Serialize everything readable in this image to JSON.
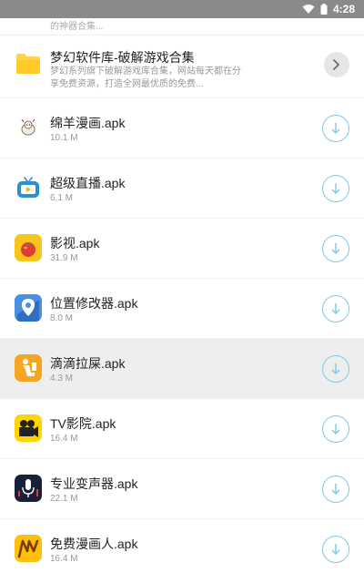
{
  "status_bar": {
    "time": "4:28"
  },
  "previous_item": {
    "desc_tail": "的神器合集..."
  },
  "folder": {
    "title": "梦幻软件库-破解游戏合集",
    "description": "梦幻系列旗下破解游戏库合集，网站每天都在分享免费资源，打造全网最优质的免费..."
  },
  "apps": [
    {
      "name": "绵羊漫画.apk",
      "size": "10.1 M",
      "icon": "sheep-comic-icon"
    },
    {
      "name": "超级直播.apk",
      "size": "6.1 M",
      "icon": "tv-live-icon"
    },
    {
      "name": "影视.apk",
      "size": "31.9 M",
      "icon": "tomato-video-icon"
    },
    {
      "name": "位置修改器.apk",
      "size": "8.0 M",
      "icon": "location-pin-icon"
    },
    {
      "name": "滴滴拉屎.apk",
      "size": "4.3 M",
      "icon": "toilet-figure-icon"
    },
    {
      "name": "TV影院.apk",
      "size": "16.4 M",
      "icon": "film-camera-icon"
    },
    {
      "name": "专业变声器.apk",
      "size": "22.1 M",
      "icon": "microphone-icon"
    },
    {
      "name": "免费漫画人.apk",
      "size": "16.4 M",
      "icon": "manga-m-icon"
    }
  ],
  "colors": {
    "accent": "#7fc7e8",
    "status_bar": "#8a8a8a",
    "highlight_row": "#eeeeee",
    "folder": "#ffd54a"
  }
}
